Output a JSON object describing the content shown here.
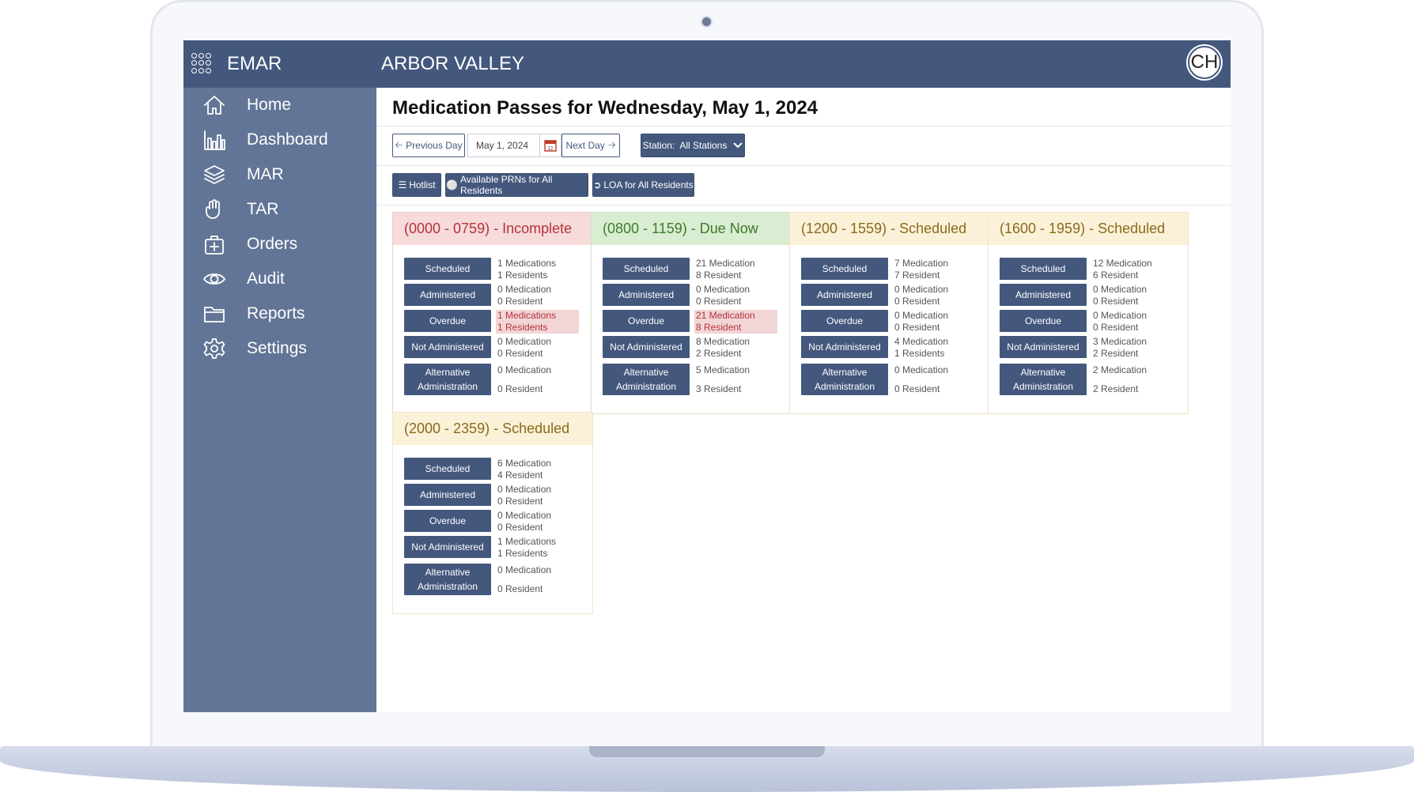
{
  "app": {
    "name": "EMAR",
    "facility": "ARBOR VALLEY",
    "user_initials": "CH"
  },
  "sidebar": {
    "items": [
      {
        "label": "Home",
        "icon": "home-icon"
      },
      {
        "label": "Dashboard",
        "icon": "bar-chart-icon"
      },
      {
        "label": "MAR",
        "icon": "layers-icon"
      },
      {
        "label": "TAR",
        "icon": "hand-icon"
      },
      {
        "label": "Orders",
        "icon": "medkit-icon"
      },
      {
        "label": "Audit",
        "icon": "eye-icon"
      },
      {
        "label": "Reports",
        "icon": "folder-icon"
      },
      {
        "label": "Settings",
        "icon": "gear-icon"
      }
    ]
  },
  "page": {
    "title": "Medication Passes for Wednesday, May 1, 2024"
  },
  "toolbar": {
    "prev_label": "Previous Day",
    "date_value": "May 1, 2024",
    "next_label": "Next Day",
    "station_label": "Station:  All Stations",
    "hotlist_label": "Hotlist",
    "prn_label": "Available PRNs for All Residents",
    "loa_label": "LOA for All Residents"
  },
  "colors": {
    "primary": "#44587d",
    "sidebar": "#627596",
    "incomplete": "#b4333a",
    "due_now": "#3e7b2a",
    "scheduled": "#8a6a1a"
  },
  "passes": [
    {
      "title": "(0000 - 0759) - Incomplete",
      "status": "incomplete",
      "rows": [
        {
          "label": "Scheduled",
          "line1": "1 Medications",
          "line2": "1 Residents"
        },
        {
          "label": "Administered",
          "line1": "0 Medication",
          "line2": "0 Resident"
        },
        {
          "label": "Overdue",
          "line1": "1 Medications",
          "line2": "1 Residents",
          "highlight": true
        },
        {
          "label": "Not Administered",
          "line1": "0 Medication",
          "line2": "0 Resident"
        },
        {
          "label": "Alternative Administration",
          "line1": "0 Medication",
          "line2": "0 Resident"
        }
      ]
    },
    {
      "title": "(0800 - 1159) - Due Now",
      "status": "due_now",
      "rows": [
        {
          "label": "Scheduled",
          "line1": "21 Medication",
          "line2": "8 Resident"
        },
        {
          "label": "Administered",
          "line1": "0 Medication",
          "line2": "0 Resident"
        },
        {
          "label": "Overdue",
          "line1": "21 Medication",
          "line2": "8 Resident",
          "highlight": true
        },
        {
          "label": "Not Administered",
          "line1": "8 Medication",
          "line2": "2 Resident"
        },
        {
          "label": "Alternative Administration",
          "line1": "5 Medication",
          "line2": "3 Resident"
        }
      ]
    },
    {
      "title": "(1200 - 1559) - Scheduled",
      "status": "scheduled",
      "rows": [
        {
          "label": "Scheduled",
          "line1": "7 Medication",
          "line2": "7 Resident"
        },
        {
          "label": "Administered",
          "line1": "0 Medication",
          "line2": "0 Resident"
        },
        {
          "label": "Overdue",
          "line1": "0 Medication",
          "line2": "0 Resident"
        },
        {
          "label": "Not Administered",
          "line1": "4 Medication",
          "line2": "1 Residents"
        },
        {
          "label": "Alternative Administration",
          "line1": "0 Medication",
          "line2": "0 Resident"
        }
      ]
    },
    {
      "title": "(1600 - 1959) - Scheduled",
      "status": "scheduled",
      "rows": [
        {
          "label": "Scheduled",
          "line1": "12 Medication",
          "line2": "6 Resident"
        },
        {
          "label": "Administered",
          "line1": "0 Medication",
          "line2": "0 Resident"
        },
        {
          "label": "Overdue",
          "line1": "0 Medication",
          "line2": "0 Resident"
        },
        {
          "label": "Not Administered",
          "line1": "3 Medication",
          "line2": "2 Resident"
        },
        {
          "label": "Alternative Administration",
          "line1": "2 Medication",
          "line2": "2 Resident"
        }
      ]
    },
    {
      "title": "(2000 - 2359) - Scheduled",
      "status": "scheduled",
      "rows": [
        {
          "label": "Scheduled",
          "line1": "6 Medication",
          "line2": "4 Resident"
        },
        {
          "label": "Administered",
          "line1": "0 Medication",
          "line2": "0 Resident"
        },
        {
          "label": "Overdue",
          "line1": "0 Medication",
          "line2": "0 Resident"
        },
        {
          "label": "Not Administered",
          "line1": "1 Medications",
          "line2": "1 Residents"
        },
        {
          "label": "Alternative Administration",
          "line1": "0 Medication",
          "line2": "0 Resident"
        }
      ]
    }
  ],
  "help": {
    "label": "?"
  }
}
